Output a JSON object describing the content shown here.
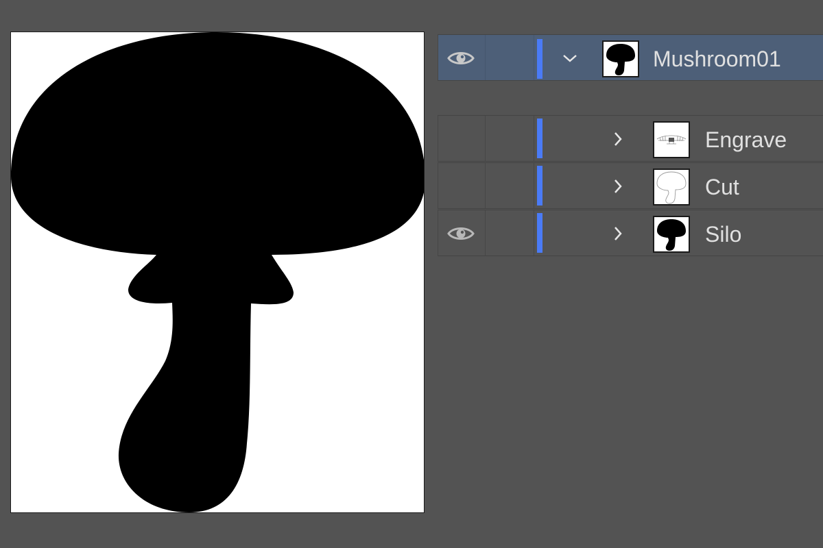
{
  "layers_panel": {
    "layers": [
      {
        "name": "Mushroom01",
        "visible": true,
        "expanded": true,
        "selected": true,
        "level": 0,
        "layer_color": "#4a7bf7"
      },
      {
        "name": "Engrave",
        "visible": false,
        "expanded": false,
        "selected": false,
        "level": 1,
        "layer_color": "#4a7bf7"
      },
      {
        "name": "Cut",
        "visible": false,
        "expanded": false,
        "selected": false,
        "level": 1,
        "layer_color": "#4a7bf7"
      },
      {
        "name": "Silo",
        "visible": true,
        "expanded": false,
        "selected": false,
        "level": 1,
        "layer_color": "#4a7bf7"
      }
    ]
  },
  "colors": {
    "workspace_bg": "#535353",
    "selected_row_bg": "#4d5f78",
    "layer_color_bar": "#4a7bf7",
    "text": "#e0e0e0",
    "artboard_bg": "#ffffff",
    "artwork_fill": "#000000"
  },
  "icons": {
    "visibility": "eye-icon",
    "expanded": "chevron-down-icon",
    "collapsed": "chevron-right-icon"
  }
}
